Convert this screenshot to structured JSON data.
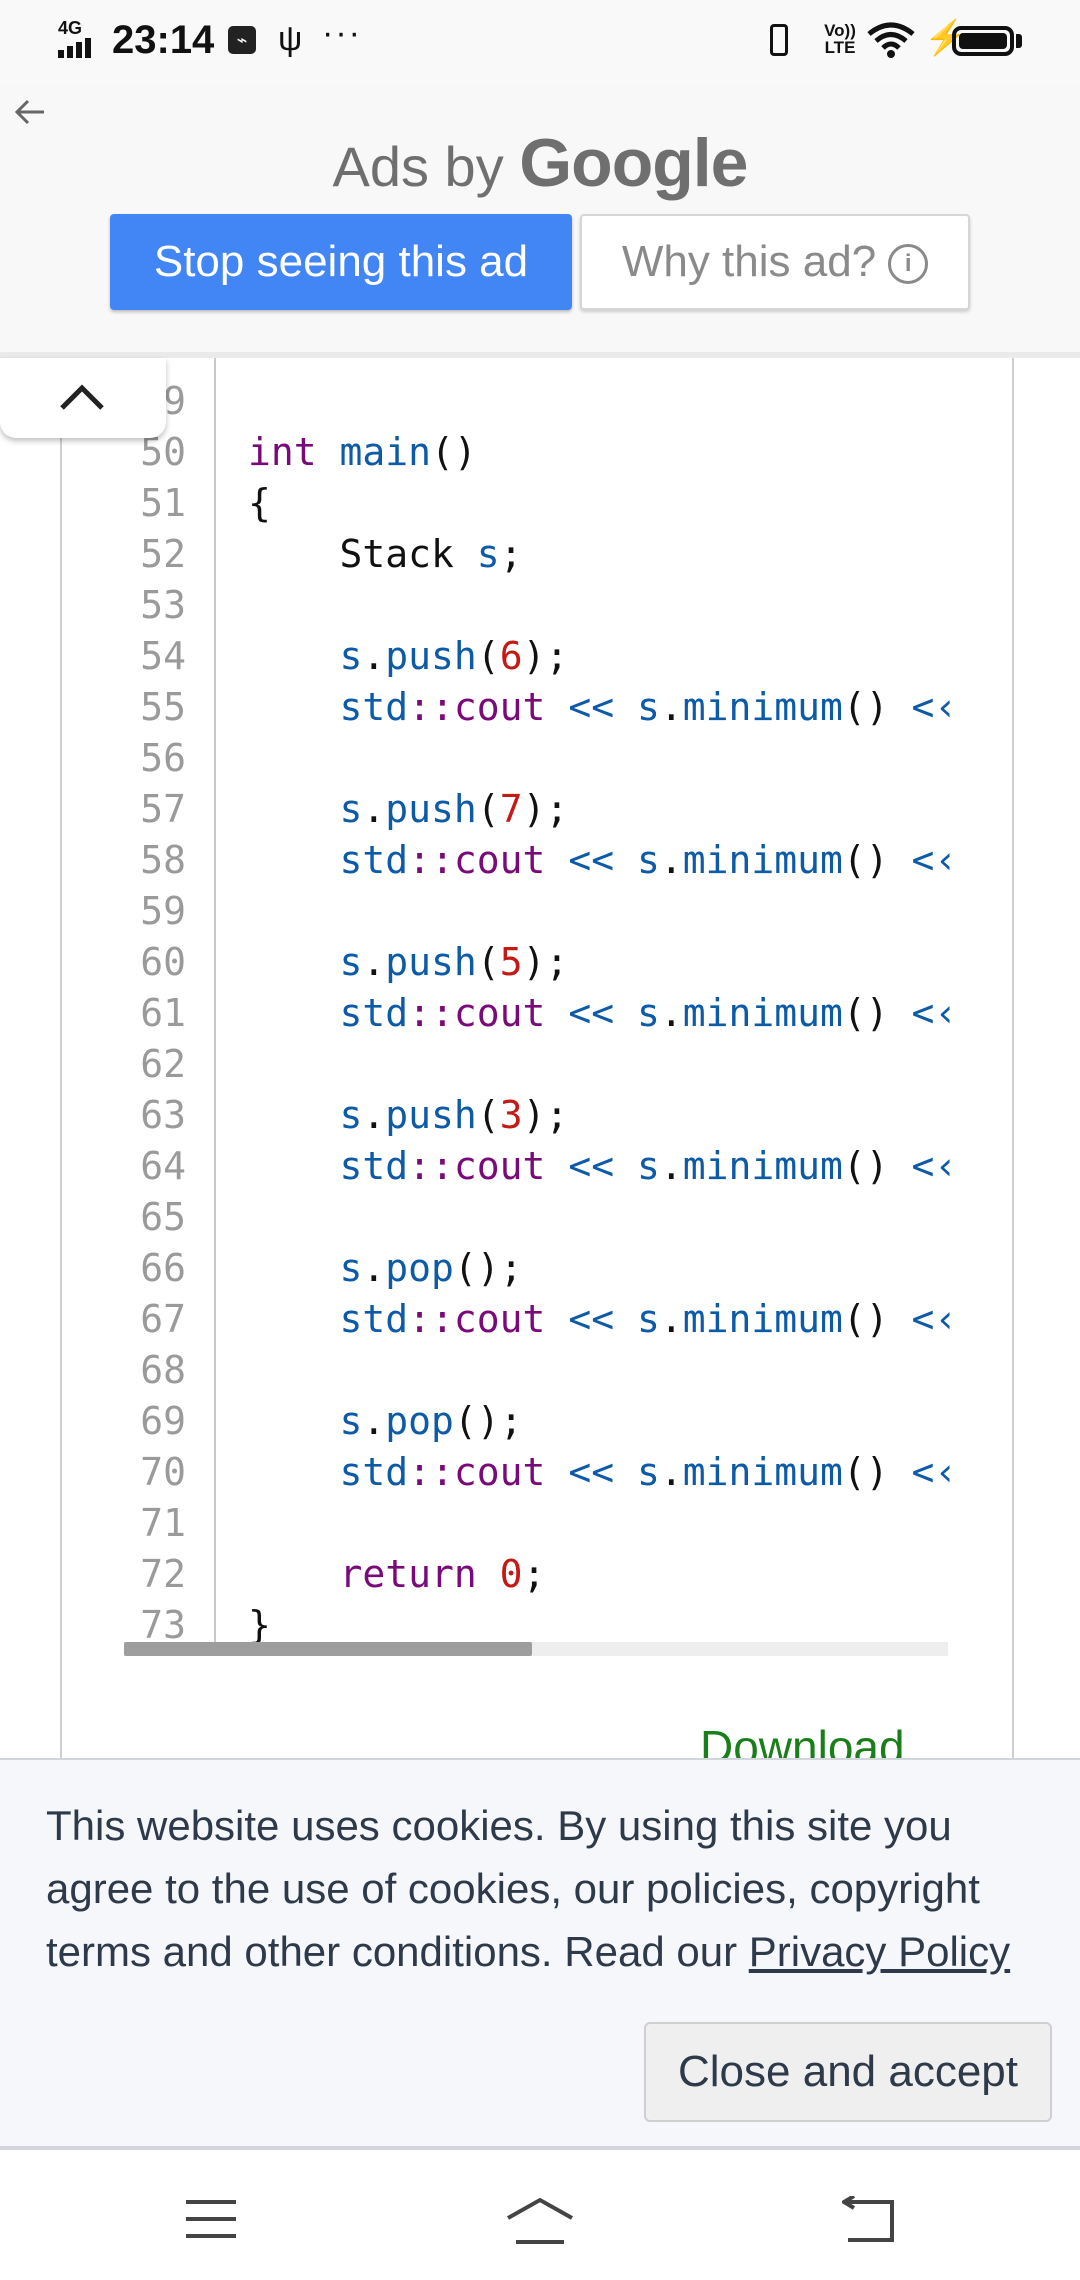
{
  "status_bar": {
    "network": "4G",
    "time": "23:14",
    "volte": "Vo)) LTE"
  },
  "ad": {
    "ads_by": "Ads by",
    "brand": "Google",
    "stop_label": "Stop seeing this ad",
    "why_label": "Why this ad?"
  },
  "code": {
    "lines": [
      {
        "n": "49",
        "tokens": []
      },
      {
        "n": "50",
        "tokens": [
          [
            "kw",
            "int "
          ],
          [
            "fn",
            "main"
          ],
          [
            "plain",
            "()"
          ]
        ]
      },
      {
        "n": "51",
        "tokens": [
          [
            "plain",
            "{"
          ]
        ]
      },
      {
        "n": "52",
        "tokens": [
          [
            "plain",
            "    Stack "
          ],
          [
            "fn",
            "s"
          ],
          [
            "plain",
            ";"
          ]
        ]
      },
      {
        "n": "53",
        "tokens": []
      },
      {
        "n": "54",
        "tokens": [
          [
            "plain",
            "    "
          ],
          [
            "fn",
            "s"
          ],
          [
            "plain",
            "."
          ],
          [
            "fn",
            "push"
          ],
          [
            "plain",
            "("
          ],
          [
            "num",
            "6"
          ],
          [
            "plain",
            ");"
          ]
        ]
      },
      {
        "n": "55",
        "tokens": [
          [
            "plain",
            "    "
          ],
          [
            "fn",
            "std"
          ],
          [
            "kw",
            "::"
          ],
          [
            "kw",
            "cout"
          ],
          [
            "fn",
            " << "
          ],
          [
            "fn",
            "s"
          ],
          [
            "plain",
            "."
          ],
          [
            "fn",
            "minimum"
          ],
          [
            "plain",
            "() "
          ],
          [
            "fn",
            "<‹"
          ]
        ]
      },
      {
        "n": "56",
        "tokens": []
      },
      {
        "n": "57",
        "tokens": [
          [
            "plain",
            "    "
          ],
          [
            "fn",
            "s"
          ],
          [
            "plain",
            "."
          ],
          [
            "fn",
            "push"
          ],
          [
            "plain",
            "("
          ],
          [
            "num",
            "7"
          ],
          [
            "plain",
            ");"
          ]
        ]
      },
      {
        "n": "58",
        "tokens": [
          [
            "plain",
            "    "
          ],
          [
            "fn",
            "std"
          ],
          [
            "kw",
            "::"
          ],
          [
            "kw",
            "cout"
          ],
          [
            "fn",
            " << "
          ],
          [
            "fn",
            "s"
          ],
          [
            "plain",
            "."
          ],
          [
            "fn",
            "minimum"
          ],
          [
            "plain",
            "() "
          ],
          [
            "fn",
            "<‹"
          ]
        ]
      },
      {
        "n": "59",
        "tokens": []
      },
      {
        "n": "60",
        "tokens": [
          [
            "plain",
            "    "
          ],
          [
            "fn",
            "s"
          ],
          [
            "plain",
            "."
          ],
          [
            "fn",
            "push"
          ],
          [
            "plain",
            "("
          ],
          [
            "num",
            "5"
          ],
          [
            "plain",
            ");"
          ]
        ]
      },
      {
        "n": "61",
        "tokens": [
          [
            "plain",
            "    "
          ],
          [
            "fn",
            "std"
          ],
          [
            "kw",
            "::"
          ],
          [
            "kw",
            "cout"
          ],
          [
            "fn",
            " << "
          ],
          [
            "fn",
            "s"
          ],
          [
            "plain",
            "."
          ],
          [
            "fn",
            "minimum"
          ],
          [
            "plain",
            "() "
          ],
          [
            "fn",
            "<‹"
          ]
        ]
      },
      {
        "n": "62",
        "tokens": []
      },
      {
        "n": "63",
        "tokens": [
          [
            "plain",
            "    "
          ],
          [
            "fn",
            "s"
          ],
          [
            "plain",
            "."
          ],
          [
            "fn",
            "push"
          ],
          [
            "plain",
            "("
          ],
          [
            "num",
            "3"
          ],
          [
            "plain",
            ");"
          ]
        ]
      },
      {
        "n": "64",
        "tokens": [
          [
            "plain",
            "    "
          ],
          [
            "fn",
            "std"
          ],
          [
            "kw",
            "::"
          ],
          [
            "kw",
            "cout"
          ],
          [
            "fn",
            " << "
          ],
          [
            "fn",
            "s"
          ],
          [
            "plain",
            "."
          ],
          [
            "fn",
            "minimum"
          ],
          [
            "plain",
            "() "
          ],
          [
            "fn",
            "<‹"
          ]
        ]
      },
      {
        "n": "65",
        "tokens": []
      },
      {
        "n": "66",
        "tokens": [
          [
            "plain",
            "    "
          ],
          [
            "fn",
            "s"
          ],
          [
            "plain",
            "."
          ],
          [
            "fn",
            "pop"
          ],
          [
            "plain",
            "();"
          ]
        ]
      },
      {
        "n": "67",
        "tokens": [
          [
            "plain",
            "    "
          ],
          [
            "fn",
            "std"
          ],
          [
            "kw",
            "::"
          ],
          [
            "kw",
            "cout"
          ],
          [
            "fn",
            " << "
          ],
          [
            "fn",
            "s"
          ],
          [
            "plain",
            "."
          ],
          [
            "fn",
            "minimum"
          ],
          [
            "plain",
            "() "
          ],
          [
            "fn",
            "<‹"
          ]
        ]
      },
      {
        "n": "68",
        "tokens": []
      },
      {
        "n": "69",
        "tokens": [
          [
            "plain",
            "    "
          ],
          [
            "fn",
            "s"
          ],
          [
            "plain",
            "."
          ],
          [
            "fn",
            "pop"
          ],
          [
            "plain",
            "();"
          ]
        ]
      },
      {
        "n": "70",
        "tokens": [
          [
            "plain",
            "    "
          ],
          [
            "fn",
            "std"
          ],
          [
            "kw",
            "::"
          ],
          [
            "kw",
            "cout"
          ],
          [
            "fn",
            " << "
          ],
          [
            "fn",
            "s"
          ],
          [
            "plain",
            "."
          ],
          [
            "fn",
            "minimum"
          ],
          [
            "plain",
            "() "
          ],
          [
            "fn",
            "<‹"
          ]
        ]
      },
      {
        "n": "71",
        "tokens": []
      },
      {
        "n": "72",
        "tokens": [
          [
            "plain",
            "    "
          ],
          [
            "kw",
            "return "
          ],
          [
            "num",
            "0"
          ],
          [
            "plain",
            ";"
          ]
        ]
      },
      {
        "n": "73",
        "tokens": [
          [
            "plain",
            "}"
          ]
        ]
      }
    ],
    "download_label": "Download"
  },
  "cookie": {
    "text": "This website uses cookies. By using this site you agree to the use of cookies, our policies, copyright terms and other conditions. Read our ",
    "link": "Privacy Policy",
    "button": "Close and accept"
  },
  "colors": {
    "ad_button_blue": "#4285f4",
    "keyword": "#7a0a7a",
    "identifier": "#0d5aa7",
    "number": "#c41a16",
    "download_green": "#1a7f1a"
  },
  "icons": [
    "back-arrow-icon",
    "chevron-up-icon",
    "info-icon",
    "usb-icon",
    "wifi-icon",
    "battery-icon",
    "menu-icon",
    "home-icon",
    "back-icon"
  ]
}
